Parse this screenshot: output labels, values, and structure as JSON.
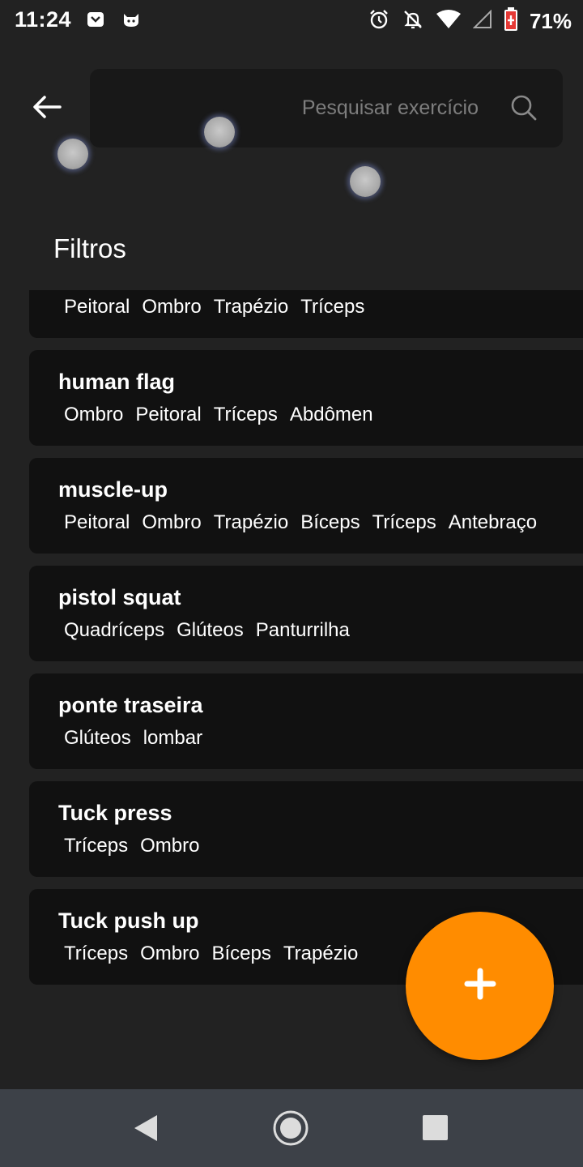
{
  "status_bar": {
    "time": "11:24",
    "battery": "71%",
    "icons": [
      "notification-icon",
      "cat-icon",
      "alarm-icon",
      "mute-icon",
      "wifi-icon",
      "signal-icon",
      "battery-icon"
    ]
  },
  "search": {
    "placeholder": "Pesquisar exercício",
    "icons": [
      "back-arrow-icon",
      "search-icon"
    ]
  },
  "filters_title": "Filtros",
  "exercises": [
    {
      "name": "",
      "muscles": [
        "Peitoral",
        "Ombro",
        "Trapézio",
        "Tríceps"
      ]
    },
    {
      "name": "human flag",
      "muscles": [
        "Ombro",
        "Peitoral",
        "Tríceps",
        "Abdômen"
      ]
    },
    {
      "name": "muscle-up",
      "muscles": [
        "Peitoral",
        "Ombro",
        "Trapézio",
        "Bíceps",
        "Tríceps",
        "Antebraço"
      ]
    },
    {
      "name": "pistol squat",
      "muscles": [
        "Quadríceps",
        "Glúteos",
        "Panturrilha"
      ]
    },
    {
      "name": "ponte traseira",
      "muscles": [
        "Glúteos",
        "lombar"
      ]
    },
    {
      "name": "Tuck press",
      "muscles": [
        "Tríceps",
        "Ombro"
      ]
    },
    {
      "name": "Tuck push up",
      "muscles": [
        "Tríceps",
        "Ombro",
        "Bíceps",
        "Trapézio"
      ]
    }
  ],
  "fab": {
    "icon": "plus-icon",
    "color": "#ff8c00"
  },
  "nav_bar": {
    "icons": [
      "nav-back-icon",
      "nav-home-icon",
      "nav-recents-icon"
    ]
  },
  "colors": {
    "background": "#222222",
    "card": "#111111",
    "accent": "#ff8c00"
  }
}
